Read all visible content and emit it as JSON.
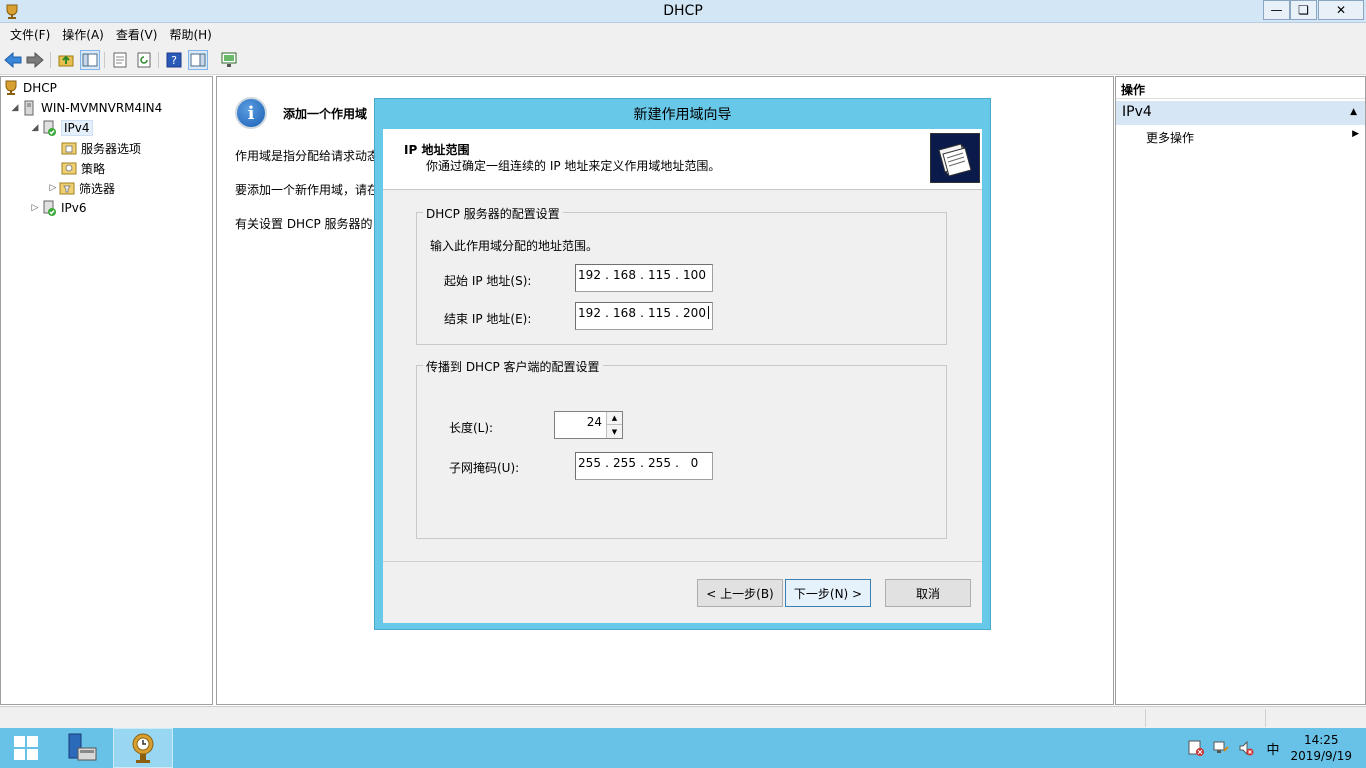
{
  "window": {
    "title": "DHCP",
    "minimize_icon": "minimize-icon",
    "restore_icon": "restore-icon",
    "close_icon": "close-icon"
  },
  "menu": [
    "文件(F)",
    "操作(A)",
    "查看(V)",
    "帮助(H)"
  ],
  "tree": {
    "root": "DHCP",
    "server": "WIN-MVMNVRM4IN4",
    "ipv4": "IPv4",
    "server_options": "服务器选项",
    "policies": "策略",
    "filters": "筛选器",
    "ipv6": "IPv6"
  },
  "center": {
    "title": "添加一个作用域",
    "line1": "作用域是指分配给请求动态",
    "line2": "要添加一个新作用域，请在",
    "line3": "有关设置 DHCP 服务器的"
  },
  "actions": {
    "header": "操作",
    "group": "IPv4",
    "more": "更多操作"
  },
  "dialog": {
    "title": "新建作用域向导",
    "heading": "IP 地址范围",
    "subheading": "你通过确定一组连续的 IP 地址来定义作用域地址范围。",
    "group1_legend": "DHCP 服务器的配置设置",
    "group1_hint": "输入此作用域分配的地址范围。",
    "start_label": "起始 IP 地址(S):",
    "start_ip": [
      "192",
      "168",
      "115",
      "100"
    ],
    "end_label": "结束 IP 地址(E):",
    "end_ip": [
      "192",
      "168",
      "115",
      "200"
    ],
    "group2_legend": "传播到 DHCP 客户端的配置设置",
    "length_label": "长度(L):",
    "length_value": "24",
    "mask_label": "子网掩码(U):",
    "mask_ip": [
      "255",
      "255",
      "255",
      "0"
    ],
    "back_button": "< 上一步(B)",
    "next_button": "下一步(N) >",
    "cancel_button": "取消"
  },
  "taskbar": {
    "ime": "中",
    "time": "14:25",
    "date": "2019/9/19"
  }
}
